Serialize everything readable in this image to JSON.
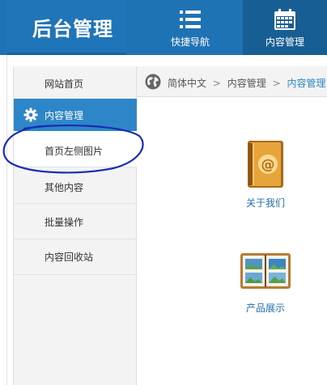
{
  "header": {
    "brand": "后台管理",
    "nav": [
      {
        "label": "快捷导航",
        "icon": "list-icon"
      },
      {
        "label": "内容管理",
        "icon": "calendar-icon"
      }
    ]
  },
  "sidebar": {
    "items": [
      {
        "label": "网站首页"
      },
      {
        "label": "内容管理",
        "icon": "gear-icon"
      },
      {
        "label": "首页左侧图片"
      },
      {
        "label": "其他内容"
      },
      {
        "label": "批量操作"
      },
      {
        "label": "内容回收站"
      }
    ]
  },
  "breadcrumb": {
    "icon": "globe-icon",
    "items": [
      "简体中文",
      "内容管理",
      "内容管理"
    ],
    "separator": ">"
  },
  "main": {
    "tiles": [
      {
        "label": "关于我们",
        "icon": "address-book-icon"
      },
      {
        "label": "产品展示",
        "icon": "photo-album-icon"
      }
    ]
  },
  "colors": {
    "header_bg": "#1e73b4",
    "active_nav_bg": "#175e94",
    "sidebar_active_bg": "#2c86c8",
    "link": "#1f6fb1",
    "annotation": "#1a2bb5"
  }
}
